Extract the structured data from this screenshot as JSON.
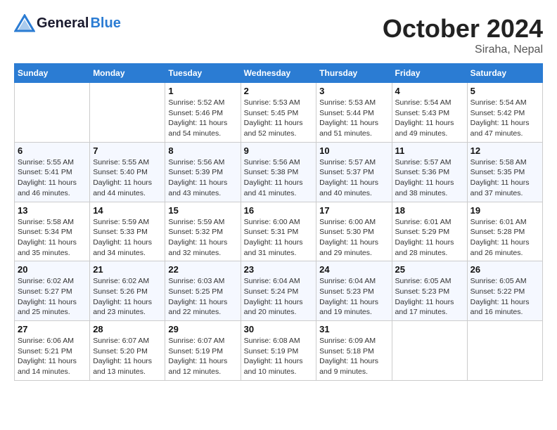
{
  "header": {
    "logo_general": "General",
    "logo_blue": "Blue",
    "month": "October 2024",
    "location": "Siraha, Nepal"
  },
  "weekdays": [
    "Sunday",
    "Monday",
    "Tuesday",
    "Wednesday",
    "Thursday",
    "Friday",
    "Saturday"
  ],
  "weeks": [
    [
      {
        "day": "",
        "sunrise": "",
        "sunset": "",
        "daylight": ""
      },
      {
        "day": "",
        "sunrise": "",
        "sunset": "",
        "daylight": ""
      },
      {
        "day": "1",
        "sunrise": "Sunrise: 5:52 AM",
        "sunset": "Sunset: 5:46 PM",
        "daylight": "Daylight: 11 hours and 54 minutes."
      },
      {
        "day": "2",
        "sunrise": "Sunrise: 5:53 AM",
        "sunset": "Sunset: 5:45 PM",
        "daylight": "Daylight: 11 hours and 52 minutes."
      },
      {
        "day": "3",
        "sunrise": "Sunrise: 5:53 AM",
        "sunset": "Sunset: 5:44 PM",
        "daylight": "Daylight: 11 hours and 51 minutes."
      },
      {
        "day": "4",
        "sunrise": "Sunrise: 5:54 AM",
        "sunset": "Sunset: 5:43 PM",
        "daylight": "Daylight: 11 hours and 49 minutes."
      },
      {
        "day": "5",
        "sunrise": "Sunrise: 5:54 AM",
        "sunset": "Sunset: 5:42 PM",
        "daylight": "Daylight: 11 hours and 47 minutes."
      }
    ],
    [
      {
        "day": "6",
        "sunrise": "Sunrise: 5:55 AM",
        "sunset": "Sunset: 5:41 PM",
        "daylight": "Daylight: 11 hours and 46 minutes."
      },
      {
        "day": "7",
        "sunrise": "Sunrise: 5:55 AM",
        "sunset": "Sunset: 5:40 PM",
        "daylight": "Daylight: 11 hours and 44 minutes."
      },
      {
        "day": "8",
        "sunrise": "Sunrise: 5:56 AM",
        "sunset": "Sunset: 5:39 PM",
        "daylight": "Daylight: 11 hours and 43 minutes."
      },
      {
        "day": "9",
        "sunrise": "Sunrise: 5:56 AM",
        "sunset": "Sunset: 5:38 PM",
        "daylight": "Daylight: 11 hours and 41 minutes."
      },
      {
        "day": "10",
        "sunrise": "Sunrise: 5:57 AM",
        "sunset": "Sunset: 5:37 PM",
        "daylight": "Daylight: 11 hours and 40 minutes."
      },
      {
        "day": "11",
        "sunrise": "Sunrise: 5:57 AM",
        "sunset": "Sunset: 5:36 PM",
        "daylight": "Daylight: 11 hours and 38 minutes."
      },
      {
        "day": "12",
        "sunrise": "Sunrise: 5:58 AM",
        "sunset": "Sunset: 5:35 PM",
        "daylight": "Daylight: 11 hours and 37 minutes."
      }
    ],
    [
      {
        "day": "13",
        "sunrise": "Sunrise: 5:58 AM",
        "sunset": "Sunset: 5:34 PM",
        "daylight": "Daylight: 11 hours and 35 minutes."
      },
      {
        "day": "14",
        "sunrise": "Sunrise: 5:59 AM",
        "sunset": "Sunset: 5:33 PM",
        "daylight": "Daylight: 11 hours and 34 minutes."
      },
      {
        "day": "15",
        "sunrise": "Sunrise: 5:59 AM",
        "sunset": "Sunset: 5:32 PM",
        "daylight": "Daylight: 11 hours and 32 minutes."
      },
      {
        "day": "16",
        "sunrise": "Sunrise: 6:00 AM",
        "sunset": "Sunset: 5:31 PM",
        "daylight": "Daylight: 11 hours and 31 minutes."
      },
      {
        "day": "17",
        "sunrise": "Sunrise: 6:00 AM",
        "sunset": "Sunset: 5:30 PM",
        "daylight": "Daylight: 11 hours and 29 minutes."
      },
      {
        "day": "18",
        "sunrise": "Sunrise: 6:01 AM",
        "sunset": "Sunset: 5:29 PM",
        "daylight": "Daylight: 11 hours and 28 minutes."
      },
      {
        "day": "19",
        "sunrise": "Sunrise: 6:01 AM",
        "sunset": "Sunset: 5:28 PM",
        "daylight": "Daylight: 11 hours and 26 minutes."
      }
    ],
    [
      {
        "day": "20",
        "sunrise": "Sunrise: 6:02 AM",
        "sunset": "Sunset: 5:27 PM",
        "daylight": "Daylight: 11 hours and 25 minutes."
      },
      {
        "day": "21",
        "sunrise": "Sunrise: 6:02 AM",
        "sunset": "Sunset: 5:26 PM",
        "daylight": "Daylight: 11 hours and 23 minutes."
      },
      {
        "day": "22",
        "sunrise": "Sunrise: 6:03 AM",
        "sunset": "Sunset: 5:25 PM",
        "daylight": "Daylight: 11 hours and 22 minutes."
      },
      {
        "day": "23",
        "sunrise": "Sunrise: 6:04 AM",
        "sunset": "Sunset: 5:24 PM",
        "daylight": "Daylight: 11 hours and 20 minutes."
      },
      {
        "day": "24",
        "sunrise": "Sunrise: 6:04 AM",
        "sunset": "Sunset: 5:23 PM",
        "daylight": "Daylight: 11 hours and 19 minutes."
      },
      {
        "day": "25",
        "sunrise": "Sunrise: 6:05 AM",
        "sunset": "Sunset: 5:23 PM",
        "daylight": "Daylight: 11 hours and 17 minutes."
      },
      {
        "day": "26",
        "sunrise": "Sunrise: 6:05 AM",
        "sunset": "Sunset: 5:22 PM",
        "daylight": "Daylight: 11 hours and 16 minutes."
      }
    ],
    [
      {
        "day": "27",
        "sunrise": "Sunrise: 6:06 AM",
        "sunset": "Sunset: 5:21 PM",
        "daylight": "Daylight: 11 hours and 14 minutes."
      },
      {
        "day": "28",
        "sunrise": "Sunrise: 6:07 AM",
        "sunset": "Sunset: 5:20 PM",
        "daylight": "Daylight: 11 hours and 13 minutes."
      },
      {
        "day": "29",
        "sunrise": "Sunrise: 6:07 AM",
        "sunset": "Sunset: 5:19 PM",
        "daylight": "Daylight: 11 hours and 12 minutes."
      },
      {
        "day": "30",
        "sunrise": "Sunrise: 6:08 AM",
        "sunset": "Sunset: 5:19 PM",
        "daylight": "Daylight: 11 hours and 10 minutes."
      },
      {
        "day": "31",
        "sunrise": "Sunrise: 6:09 AM",
        "sunset": "Sunset: 5:18 PM",
        "daylight": "Daylight: 11 hours and 9 minutes."
      },
      {
        "day": "",
        "sunrise": "",
        "sunset": "",
        "daylight": ""
      },
      {
        "day": "",
        "sunrise": "",
        "sunset": "",
        "daylight": ""
      }
    ]
  ]
}
